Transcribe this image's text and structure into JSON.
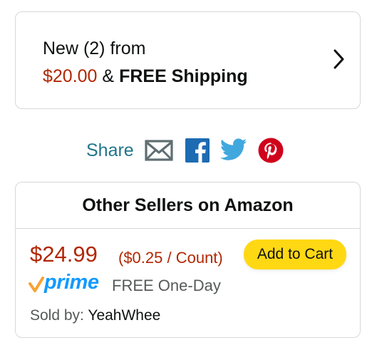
{
  "new_offers": {
    "line1": "New (2) from",
    "price": "$20.00",
    "amp": "&",
    "shipping": "FREE Shipping",
    "chevron_icon": "chevron-right-icon"
  },
  "share": {
    "label": "Share",
    "icons": [
      "email-icon",
      "facebook-icon",
      "twitter-icon",
      "pinterest-icon"
    ]
  },
  "other_sellers": {
    "title": "Other Sellers on Amazon",
    "price": "$24.99",
    "unit_price": "($0.25 / Count)",
    "add_to_cart_label": "Add to Cart",
    "prime_label": "prime",
    "delivery": "FREE One-Day",
    "sold_by_label": "Sold by:",
    "seller_name": "YeahWhee"
  },
  "colors": {
    "price_red": "#b12704",
    "link_teal": "#21758a",
    "button_yellow": "#ffd814",
    "prime_blue": "#1399ff",
    "prime_orange": "#f7a333",
    "border_gray": "#d5d9d9",
    "facebook_blue": "#1d6bb2",
    "twitter_blue": "#41a8dd",
    "pinterest_red": "#d0021b",
    "email_gray": "#5f6e71"
  }
}
